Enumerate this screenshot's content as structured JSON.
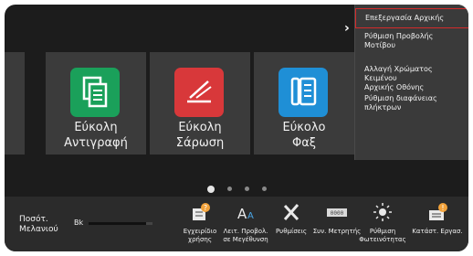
{
  "tiles": [
    {
      "label_line1": "Εύκολη",
      "label_line2": "Αντιγραφή",
      "icon": "copy-icon",
      "color": "#1aa05a"
    },
    {
      "label_line1": "Εύκολη",
      "label_line2": "Σάρωση",
      "icon": "scan-icon",
      "color": "#d8383a"
    },
    {
      "label_line1": "Εύκολο",
      "label_line2": "Φαξ",
      "icon": "fax-icon",
      "color": "#1f8fd6"
    }
  ],
  "pages": {
    "count": 4,
    "active": 1
  },
  "menu": {
    "items": [
      {
        "line1": "Επεξεργασία Αρχικής",
        "line2": ""
      },
      {
        "line1": "Ρύθμιση Προβολής",
        "line2": "Μοτίβου"
      },
      {
        "line1": "Αλλαγή Χρώματος Κειμένου",
        "line2": "Αρχικής Οθόνης"
      },
      {
        "line1": "Ρύθμιση διαφάνειας",
        "line2": "πλήκτρων"
      }
    ],
    "accent": "#d52b2b"
  },
  "toner": {
    "label_line1": "Ποσότ.",
    "label_line2": "Μελανιού",
    "color_label": "Bk",
    "level": 0.9
  },
  "bottom_buttons": [
    {
      "line1": "Εγχειρίδιο",
      "line2": "χρήσης",
      "icon": "manual-icon"
    },
    {
      "line1": "Λειτ. Προβολ.",
      "line2": "σε Μεγέθυνση",
      "icon": "zoom-text-icon"
    },
    {
      "line1": "Ρυθμίσεις",
      "line2": "",
      "icon": "settings-icon"
    },
    {
      "line1": "Συν. Μετρητής",
      "line2": "",
      "icon": "counter-icon"
    },
    {
      "line1": "Ρύθμιση",
      "line2": "Φωτεινότητας",
      "icon": "brightness-icon"
    },
    {
      "line1": "Κατάστ. Εργασ.",
      "line2": "",
      "icon": "job-status-icon"
    }
  ]
}
